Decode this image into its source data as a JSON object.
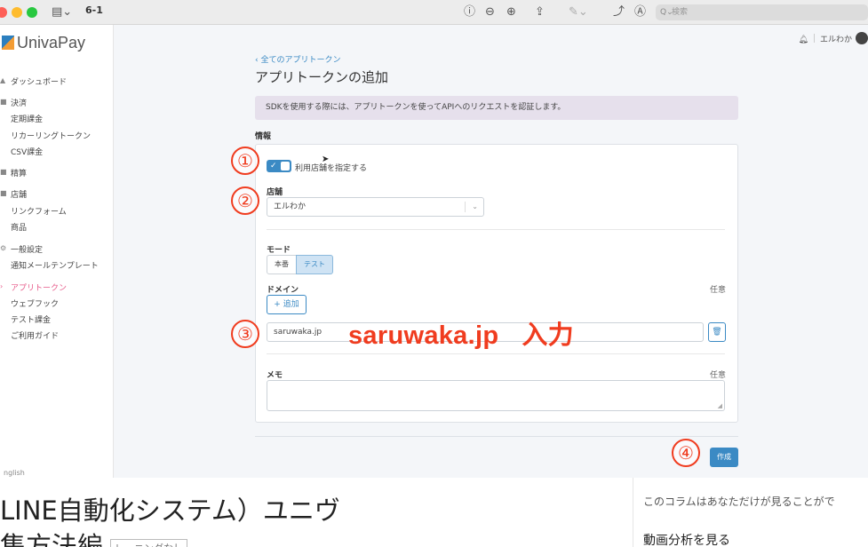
{
  "window": {
    "title": "6-1",
    "search_placeholder": "検索"
  },
  "app": {
    "logo": "UnivaPay",
    "user_name": "エルわか",
    "breadcrumb": "‹ 全てのアプリトークン",
    "page_title": "アプリトークンの追加",
    "info_banner": "SDKを使用する際には、アプリトークンを使ってAPIへのリクエストを認証します。",
    "section_label": "情報"
  },
  "sidebar": {
    "items": [
      {
        "label": "ダッシュボード"
      },
      {
        "label": "決済"
      },
      {
        "label": "定期課金"
      },
      {
        "label": "リカーリングトークン"
      },
      {
        "label": "CSV課金"
      },
      {
        "label": "精算"
      },
      {
        "label": "店舗"
      },
      {
        "label": "リンクフォーム"
      },
      {
        "label": "商品"
      },
      {
        "label": "一般設定"
      },
      {
        "label": "通知メールテンプレート"
      },
      {
        "label": "アプリトークン"
      },
      {
        "label": "ウェブフック"
      },
      {
        "label": "テスト課金"
      },
      {
        "label": "ご利用ガイド"
      }
    ],
    "language": "nglish"
  },
  "form": {
    "toggle_label": "利用店舗を指定する",
    "toggle_on": true,
    "store_label": "店舗",
    "store_value": "エルわか",
    "mode_label": "モード",
    "mode_options": [
      "本番",
      "テスト"
    ],
    "mode_selected": "テスト",
    "domain_label": "ドメイン",
    "domain_optional": "任意",
    "add_button": "+ 追加",
    "domain_value": "saruwaka.jp",
    "memo_label": "メモ",
    "memo_optional": "任意",
    "create_button": "作成"
  },
  "annotations": {
    "step1": "①",
    "step2": "②",
    "step3": "③",
    "step4": "④",
    "overlay_domain": "saruwaka.jp",
    "overlay_action": "入力"
  },
  "page_below": {
    "title_line1": "LINE自動化システム）ユニヴ",
    "title_line2": "集方法編",
    "badge": "レーニングなし",
    "column_note": "このコラムはあなただけが見ることがで",
    "column_link": "動画分析を見る"
  },
  "colors": {
    "accent": "#3b8ac4",
    "annotation": "#f03c1f",
    "active_nav": "#e75b8a"
  }
}
